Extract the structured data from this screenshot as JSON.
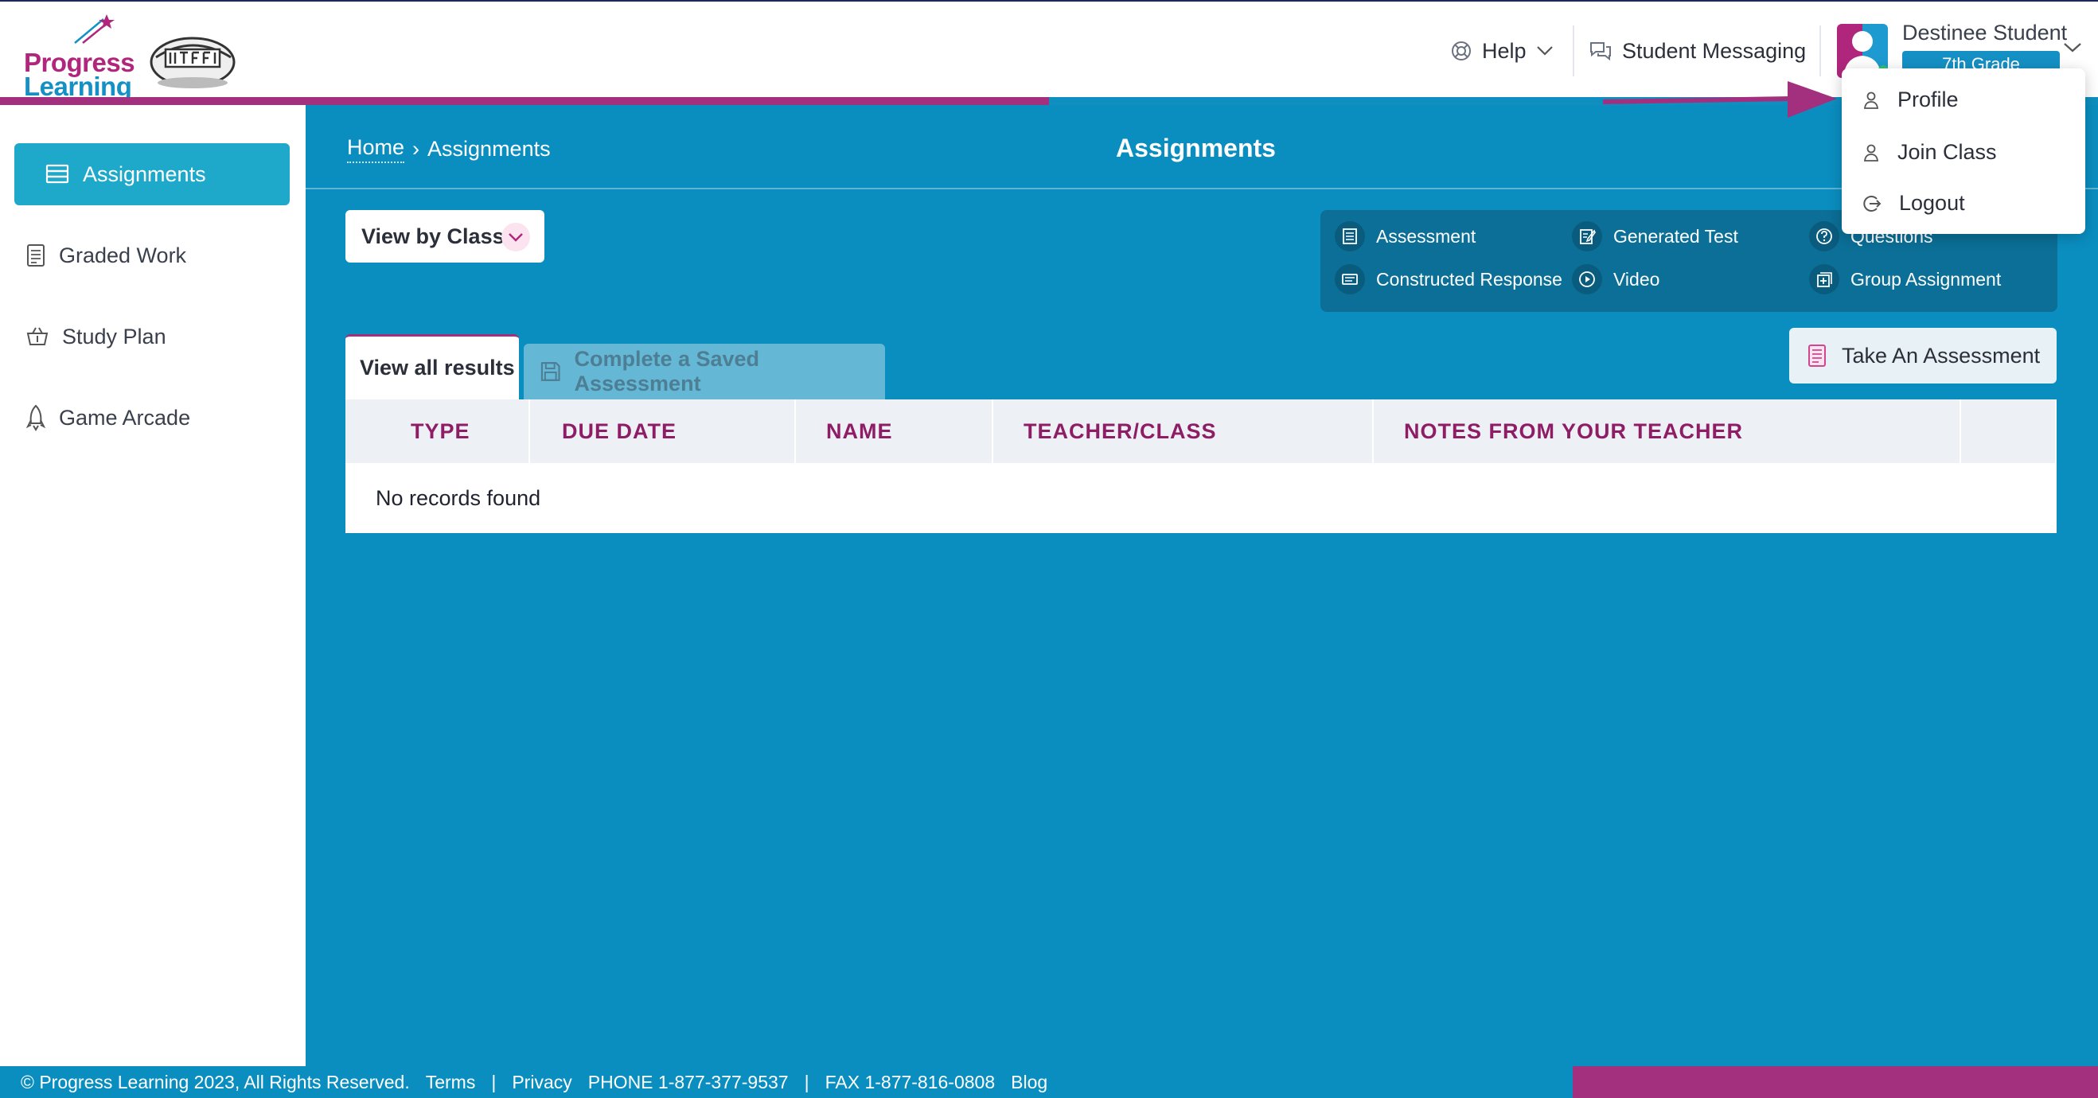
{
  "header": {
    "logo_line1": "Progress",
    "logo_line2": "Learning",
    "help_label": "Help",
    "messaging_label": "Student Messaging",
    "user_name": "Destinee Student",
    "grade_badge": "7th Grade"
  },
  "user_menu": {
    "items": [
      {
        "label": "Profile",
        "icon": "person-icon"
      },
      {
        "label": "Join Class",
        "icon": "person-icon"
      },
      {
        "label": "Logout",
        "icon": "logout-icon"
      }
    ]
  },
  "sidebar": {
    "items": [
      {
        "label": "Assignments",
        "icon": "assignments-icon",
        "active": true
      },
      {
        "label": "Graded Work",
        "icon": "graded-work-icon",
        "active": false
      },
      {
        "label": "Study Plan",
        "icon": "study-plan-icon",
        "active": false
      },
      {
        "label": "Game Arcade",
        "icon": "rocket-icon",
        "active": false
      }
    ]
  },
  "breadcrumb": {
    "home": "Home",
    "separator": "›",
    "current": "Assignments"
  },
  "page": {
    "title": "Assignments",
    "view_by_class": "View by Class",
    "take_assessment": "Take An Assessment"
  },
  "legend": {
    "items": [
      {
        "label": "Assessment",
        "icon": "assessment-icon"
      },
      {
        "label": "Generated Test",
        "icon": "generated-test-icon"
      },
      {
        "label": "Questions",
        "icon": "question-icon"
      },
      {
        "label": "Constructed Response",
        "icon": "constructed-response-icon"
      },
      {
        "label": "Video",
        "icon": "video-icon"
      },
      {
        "label": "Group Assignment",
        "icon": "group-assignment-icon"
      }
    ]
  },
  "tabs": [
    {
      "label": "View all results",
      "active": true
    },
    {
      "label": "Complete a Saved Assessment",
      "active": false
    }
  ],
  "table": {
    "columns": [
      "TYPE",
      "DUE DATE",
      "NAME",
      "TEACHER/CLASS",
      "NOTES FROM YOUR TEACHER"
    ],
    "empty_message": "No records found"
  },
  "footer": {
    "copyright": "© Progress Learning 2023, All Rights Reserved.",
    "terms": "Terms",
    "separator": "|",
    "privacy": "Privacy",
    "phone": "PHONE 1-877-377-9537",
    "fax": "FAX 1-877-816-0808",
    "blog": "Blog"
  },
  "colors": {
    "brand_magenta": "#a3307f",
    "brand_blue": "#0a8ec0",
    "active_nav": "#1ea9cb",
    "table_header_text": "#8e1d66"
  }
}
